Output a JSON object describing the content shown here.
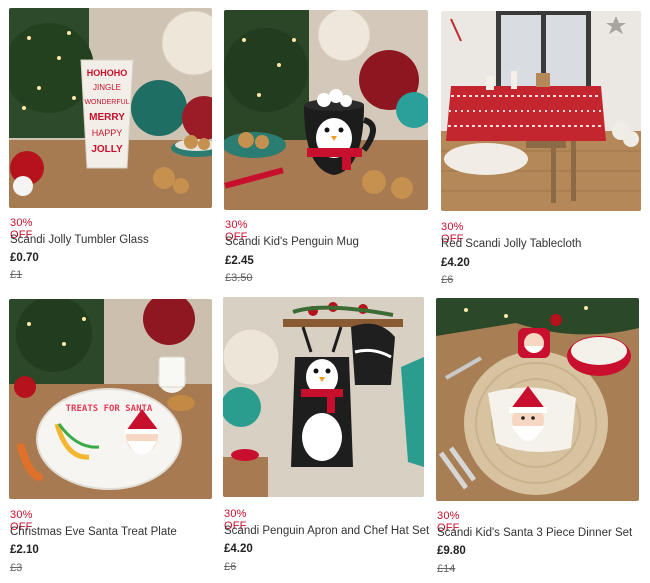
{
  "products": [
    {
      "discount": "30% OFF",
      "name": "Scandi Jolly Tumbler Glass",
      "price": "£0.70",
      "was_price": "£1",
      "image_text": [
        "HOHOHO",
        "JINGLE",
        "WONDERFUL",
        "MERRY",
        "HAPPY",
        "JOLLY"
      ]
    },
    {
      "discount": "30% OFF",
      "name": "Scandi Kid's Penguin Mug",
      "price": "£2.45",
      "was_price": "£3.50"
    },
    {
      "discount": "30% OFF",
      "name": "Red Scandi Jolly Tablecloth",
      "price": "£4.20",
      "was_price": "£6"
    },
    {
      "discount": "30% OFF",
      "name": "Christmas Eve Santa Treat Plate",
      "price": "£2.10",
      "was_price": "£3",
      "image_text": [
        "TREATS FOR SANTA"
      ]
    },
    {
      "discount": "30% OFF",
      "name": "Scandi Penguin Apron and Chef Hat Set",
      "price": "£4.20",
      "was_price": "£6"
    },
    {
      "discount": "30% OFF",
      "name": "Scandi Kid's Santa 3 Piece Dinner Set",
      "price": "£9.80",
      "was_price": "£14"
    }
  ],
  "colors": {
    "discount": "#c8102e",
    "price": "#222222",
    "was_price": "#666666"
  }
}
